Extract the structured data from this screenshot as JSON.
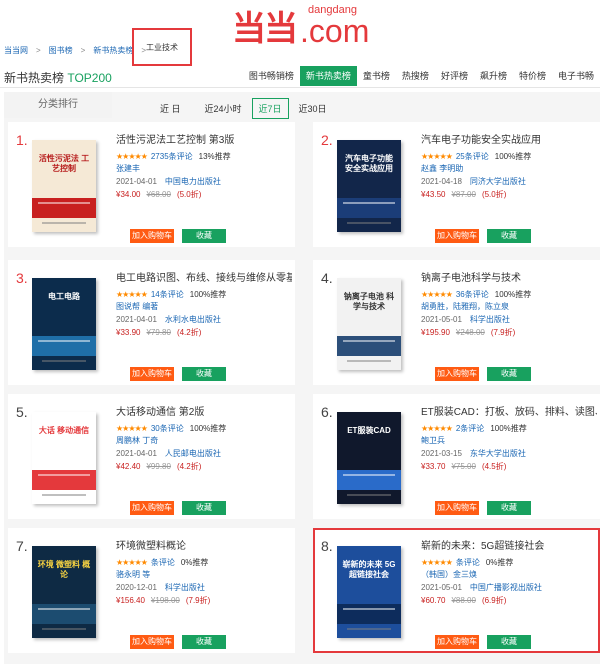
{
  "logo": {
    "mark": "当当",
    "small": "dangdang",
    "big": ".com"
  },
  "breadcrumb": {
    "items": [
      "当当网",
      "图书榜",
      "新书热卖榜"
    ],
    "current": "工业技术"
  },
  "list": {
    "title": "新书热卖榜",
    "title_highlight": "TOP200",
    "tabs": [
      "图书畅销榜",
      "新书热卖榜",
      "童书榜",
      "热搜榜",
      "好评榜",
      "飙升榜",
      "特价榜",
      "电子书畅"
    ],
    "active_tab": "新书热卖榜"
  },
  "sidebar": {
    "title": "分类排行"
  },
  "time_filter": {
    "label": "近 日",
    "options": [
      "近24小时",
      "近7日",
      "近30日"
    ],
    "active": "近7日"
  },
  "buttons": {
    "cart": "加入购物车",
    "fav": "收藏"
  },
  "colors": {
    "brand_red": "#e4393c",
    "green": "#18a15f",
    "orange_btn": "#ff5b13",
    "price_red": "#c8201f"
  },
  "books": [
    {
      "rank": "1.",
      "title": "活性污泥法工艺控制 第3版",
      "stars": "★★★★★",
      "reviews": "2735条评论",
      "recommend": "13%推荐",
      "author": "张建丰",
      "date": "2021-04-01",
      "publisher": "中国电力出版社",
      "price": "¥34.00",
      "orig_price": "¥68.00",
      "discount": "(5.0折)",
      "cover_title": "活性污泥法 工艺控制"
    },
    {
      "rank": "2.",
      "title": "汽车电子功能安全实战应用",
      "stars": "★★★★★",
      "reviews": "25条评论",
      "recommend": "100%推荐",
      "author": "赵鑫  李明助",
      "date": "2021-04-18",
      "publisher": "同济大学出版社",
      "price": "¥43.50",
      "orig_price": "¥87.00",
      "discount": "(5.0折)",
      "cover_title": "汽车电子功能 安全实战应用"
    },
    {
      "rank": "3.",
      "title": "电工电路识图、布线、接线与维修从零基",
      "stars": "★★★★★",
      "reviews": "14条评论",
      "recommend": "100%推荐",
      "author": "图说帮  编著",
      "date": "2021-04-01",
      "publisher": "水利水电出版社",
      "price": "¥33.90",
      "orig_price": "¥79.80",
      "discount": "(4.2折)",
      "cover_title": "电工电路"
    },
    {
      "rank": "4.",
      "title": "钠离子电池科学与技术",
      "stars": "★★★★★",
      "reviews": "36条评论",
      "recommend": "100%推荐",
      "author": "胡勇胜，陆雅翔，陈立泉",
      "date": "2021-05-01",
      "publisher": "科学出版社",
      "price": "¥195.90",
      "orig_price": "¥248.00",
      "discount": "(7.9折)",
      "cover_title": "钠离子电池 科学与技术"
    },
    {
      "rank": "5.",
      "title": "大话移动通信 第2版",
      "stars": "★★★★★",
      "reviews": "30条评论",
      "recommend": "100%推荐",
      "author": "周鹏林  丁奇",
      "date": "2021-04-01",
      "publisher": "人民邮电出版社",
      "price": "¥42.40",
      "orig_price": "¥99.80",
      "discount": "(4.2折)",
      "cover_title": "大话 移动通信"
    },
    {
      "rank": "6.",
      "title": "ET服装CAD：打板、放码、排料、读图、",
      "stars": "★★★★★",
      "reviews": "2条评论",
      "recommend": "100%推荐",
      "author": "鲍卫兵",
      "date": "2021-03-15",
      "publisher": "东华大学出版社",
      "price": "¥33.70",
      "orig_price": "¥75.00",
      "discount": "(4.5折)",
      "cover_title": "ET服装CAD"
    },
    {
      "rank": "7.",
      "title": "环境微塑料概论",
      "stars": "★★★★★",
      "reviews": "条评论",
      "recommend": "0%推荐",
      "author": "骆永明  等",
      "date": "2020-12-01",
      "publisher": "科学出版社",
      "price": "¥156.40",
      "orig_price": "¥198.00",
      "discount": "(7.9折)",
      "cover_title": "环境 微塑料 概论"
    },
    {
      "rank": "8.",
      "title": "崭新的未来：5G超链接社会",
      "stars": "★★★★★",
      "reviews": "条评论",
      "recommend": "0%推荐",
      "author": "（韩国）金三焕",
      "date": "2021-05-01",
      "publisher": "中国广播影视出版社",
      "price": "¥60.70",
      "orig_price": "¥88.00",
      "discount": "(6.9折)",
      "cover_title": "崭新的未来 5G超链接社会"
    }
  ]
}
